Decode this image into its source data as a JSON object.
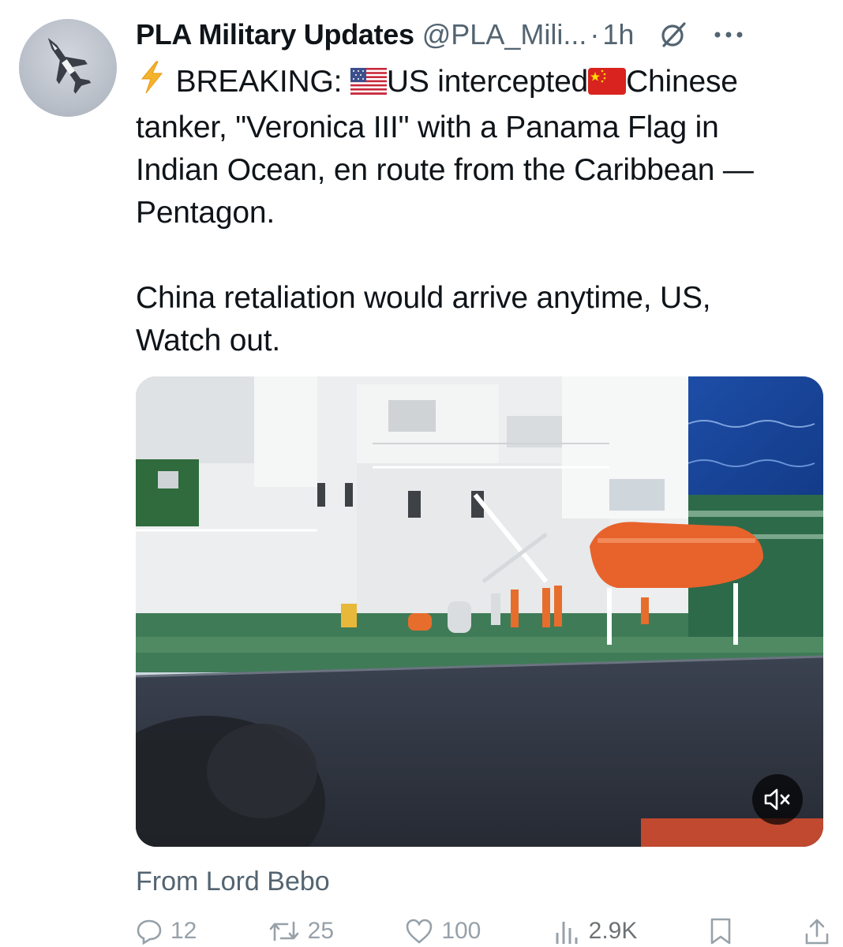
{
  "author": {
    "display_name": "PLA Military Updates",
    "handle": "@PLA_Mili...",
    "separator": "·",
    "time": "1h",
    "avatar_icon": "fighter-jet-avatar"
  },
  "tweet": {
    "line1_prefix": "BREAKING: ",
    "line1_us": "US intercepted",
    "line1_cn": "Chinese",
    "line1_rest": "tanker, \"Veronica III\" with a Panama Flag in\nIndian Ocean, en route from the Caribbean —\nPentagon.",
    "paragraph2": "China retaliation would arrive anytime, US,\nWatch out.",
    "icons": [
      "lightning-emoji",
      "us-flag-emoji",
      "china-flag-emoji"
    ]
  },
  "media": {
    "type": "video",
    "description_icon": "oil-tanker-video",
    "mute_icon": "muted-speaker-icon"
  },
  "source_text": "From Lord Bebo",
  "actions": {
    "replies": "12",
    "reposts": "25",
    "likes": "100",
    "views": "2.9K"
  },
  "colors": {
    "text": "#0f1419",
    "secondary": "#536471",
    "lifeboat": "#e8622c",
    "deck": "#3c7a55",
    "sea": "#1f4fa8"
  }
}
